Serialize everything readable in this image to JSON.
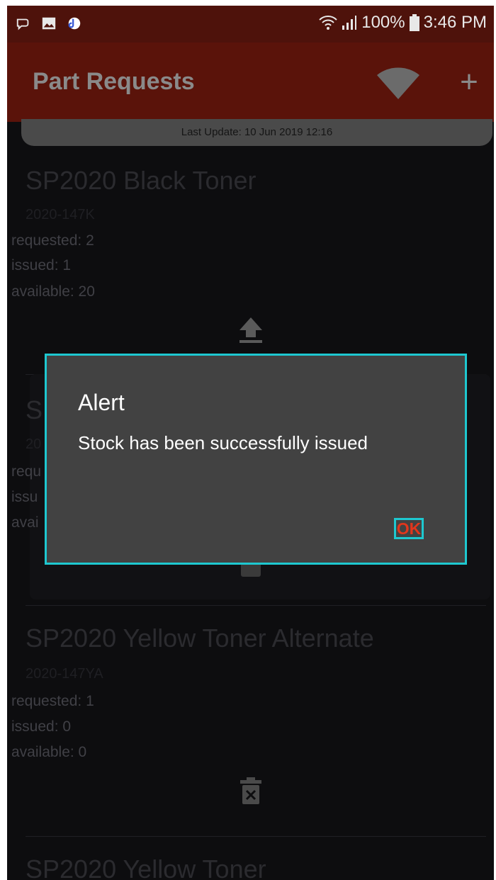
{
  "status_bar": {
    "battery": "100%",
    "time": "3:46 PM",
    "icons": [
      "chat-bubble-icon",
      "image-icon",
      "music-icon",
      "wifi-status-icon",
      "signal-icon",
      "battery-icon"
    ]
  },
  "app_bar": {
    "title": "Part Requests",
    "sync_icon": "wifi-sync-icon",
    "add_label": "+"
  },
  "last_update": "Last Update: 10 Jun 2019 12:16",
  "items": [
    {
      "title": "SP2020 Black Toner",
      "code": "2020-147K",
      "requested": "requested: 2",
      "issued": "issued: 1",
      "available": "available: 20",
      "action_icon": "upload-icon"
    },
    {
      "title": "S",
      "code": "20",
      "requested": "requ",
      "issued": "issu",
      "available": "avai",
      "action_icon": "delete-icon"
    },
    {
      "title": "SP2020 Yellow Toner Alternate",
      "code": "2020-147YA",
      "requested": "requested: 1",
      "issued": "issued: 0",
      "available": "available: 0",
      "action_icon": "delete-icon"
    },
    {
      "title": "SP2020 Yellow Toner"
    }
  ],
  "dialog": {
    "title": "Alert",
    "message": "Stock has been successfully issued",
    "ok_label": "OK"
  },
  "colors": {
    "accent": "#e2361c",
    "highlight": "#1ec8d0",
    "app_bar": "#5a130a",
    "status_bar": "#4e120b"
  }
}
